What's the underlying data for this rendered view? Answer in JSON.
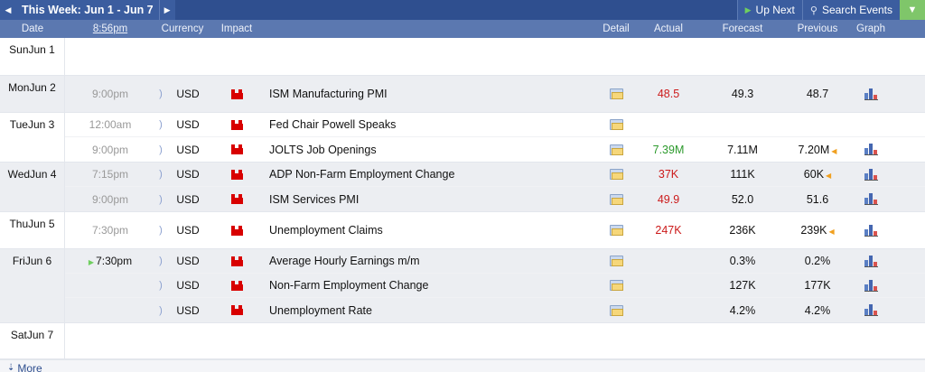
{
  "toolbar": {
    "prev_icon": "left-arrow-icon",
    "week_title": "This Week: Jun 1 - Jun 7",
    "next_icon": "right-arrow-icon",
    "up_next_label": "Up Next",
    "search_label": "Search Events",
    "filter_icon": "filter-icon"
  },
  "columns": {
    "date": "Date",
    "time": "8:56pm",
    "currency": "Currency",
    "impact": "Impact",
    "detail": "Detail",
    "actual": "Actual",
    "forecast": "Forecast",
    "previous": "Previous",
    "graph": "Graph"
  },
  "days": [
    {
      "dow": "Sun",
      "date": "Jun 1",
      "events": []
    },
    {
      "dow": "Mon",
      "date": "Jun 2",
      "events": [
        {
          "time": "9:00pm",
          "currency": "USD",
          "impact": "high",
          "event": "ISM Manufacturing PMI",
          "actual": "48.5",
          "actual_status": "worse",
          "forecast": "49.3",
          "previous": "48.7",
          "revised": false,
          "graph": true
        }
      ]
    },
    {
      "dow": "Tue",
      "date": "Jun 3",
      "events": [
        {
          "time": "12:00am",
          "currency": "USD",
          "impact": "high",
          "event": "Fed Chair Powell Speaks",
          "actual": "",
          "actual_status": "",
          "forecast": "",
          "previous": "",
          "revised": false,
          "graph": false
        },
        {
          "time": "9:00pm",
          "currency": "USD",
          "impact": "high",
          "event": "JOLTS Job Openings",
          "actual": "7.39M",
          "actual_status": "better",
          "forecast": "7.11M",
          "previous": "7.20M",
          "revised": true,
          "graph": true
        }
      ]
    },
    {
      "dow": "Wed",
      "date": "Jun 4",
      "events": [
        {
          "time": "7:15pm",
          "currency": "USD",
          "impact": "high",
          "event": "ADP Non-Farm Employment Change",
          "actual": "37K",
          "actual_status": "worse",
          "forecast": "111K",
          "previous": "60K",
          "revised": true,
          "graph": true
        },
        {
          "time": "9:00pm",
          "currency": "USD",
          "impact": "high",
          "event": "ISM Services PMI",
          "actual": "49.9",
          "actual_status": "worse",
          "forecast": "52.0",
          "previous": "51.6",
          "revised": false,
          "graph": true
        }
      ]
    },
    {
      "dow": "Thu",
      "date": "Jun 5",
      "events": [
        {
          "time": "7:30pm",
          "currency": "USD",
          "impact": "high",
          "event": "Unemployment Claims",
          "actual": "247K",
          "actual_status": "worse",
          "forecast": "236K",
          "previous": "239K",
          "revised": true,
          "graph": true
        }
      ]
    },
    {
      "dow": "Fri",
      "date": "Jun 6",
      "events": [
        {
          "time": "7:30pm",
          "upnext": true,
          "currency": "USD",
          "impact": "high",
          "event": "Average Hourly Earnings m/m",
          "actual": "",
          "actual_status": "",
          "forecast": "0.3%",
          "previous": "0.2%",
          "revised": false,
          "graph": true
        },
        {
          "time": "",
          "currency": "USD",
          "impact": "high",
          "event": "Non-Farm Employment Change",
          "actual": "",
          "actual_status": "",
          "forecast": "127K",
          "previous": "177K",
          "revised": false,
          "graph": true
        },
        {
          "time": "",
          "currency": "USD",
          "impact": "high",
          "event": "Unemployment Rate",
          "actual": "",
          "actual_status": "",
          "forecast": "4.2%",
          "previous": "4.2%",
          "revised": false,
          "graph": true
        }
      ]
    },
    {
      "dow": "Sat",
      "date": "Jun 7",
      "events": []
    }
  ],
  "footer": {
    "more_label": "More",
    "more_icon": "down-arrow-icon"
  },
  "colors": {
    "toolbar_bg": "#2f4f8f",
    "header_bg": "#5b78b0",
    "worse": "#cc1a1a",
    "better": "#2c9a2c",
    "impact_high": "#d80000",
    "filter_bg": "#7fc66a"
  }
}
